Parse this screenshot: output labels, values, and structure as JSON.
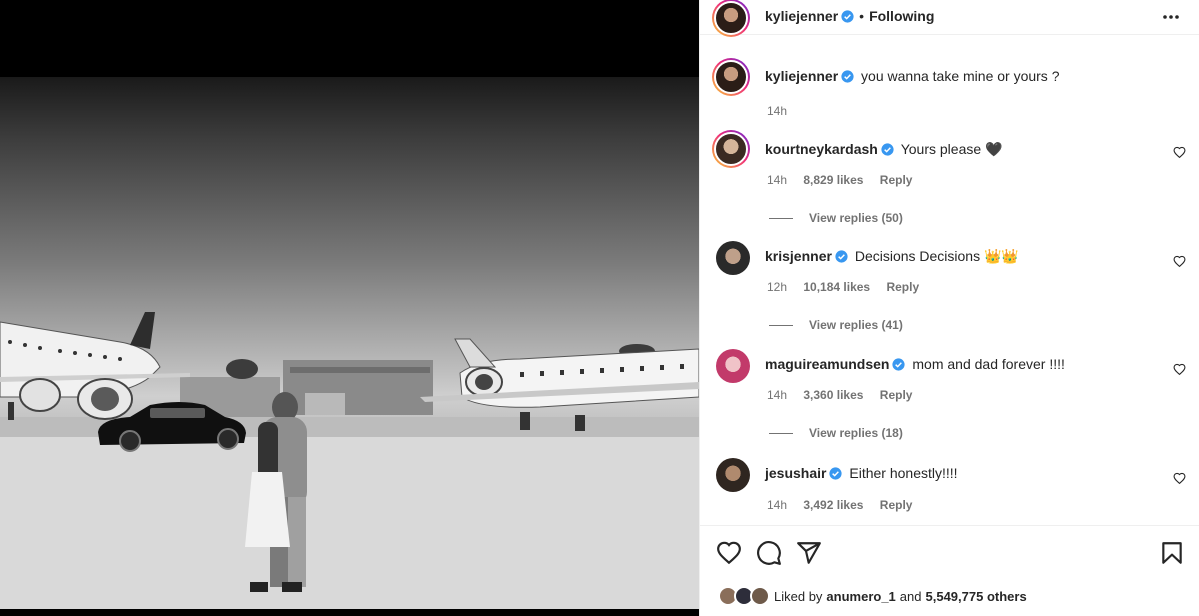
{
  "post": {
    "author": "kyliejenner",
    "separator": "•",
    "follow_state": "Following",
    "caption": "you wanna take mine or yours ?",
    "caption_time": "14h"
  },
  "comments": [
    {
      "user": "kourtneykardash",
      "text": "Yours please 🖤",
      "time": "14h",
      "likes": "8,829 likes",
      "reply": "Reply",
      "view_replies": "View replies (50)",
      "avatar_color": "#c9a98a"
    },
    {
      "user": "krisjenner",
      "text": "Decisions Decisions 👑👑",
      "time": "12h",
      "likes": "10,184 likes",
      "reply": "Reply",
      "view_replies": "View replies (41)",
      "avatar_color": "#3a3a3a"
    },
    {
      "user": "maguireamundsen",
      "text": "mom and dad forever !!!!",
      "time": "14h",
      "likes": "3,360 likes",
      "reply": "Reply",
      "view_replies": "View replies (18)",
      "avatar_color": "#d24a7a"
    },
    {
      "user": "jesushair",
      "text": "Either honestly!!!!",
      "time": "14h",
      "likes": "3,492 likes",
      "reply": "Reply",
      "avatar_color": "#5a4a3a"
    }
  ],
  "likes_line": {
    "prefix": "Liked by",
    "user": "anumero_1",
    "joiner": "and",
    "others": "5,549,775 others"
  },
  "icons": [
    "verified-badge-icon",
    "more-options-icon",
    "heart-icon",
    "comment-icon",
    "share-icon",
    "bookmark-icon"
  ],
  "colors": {
    "verified": "#3897f0",
    "text": "#262626",
    "muted": "#737373"
  }
}
